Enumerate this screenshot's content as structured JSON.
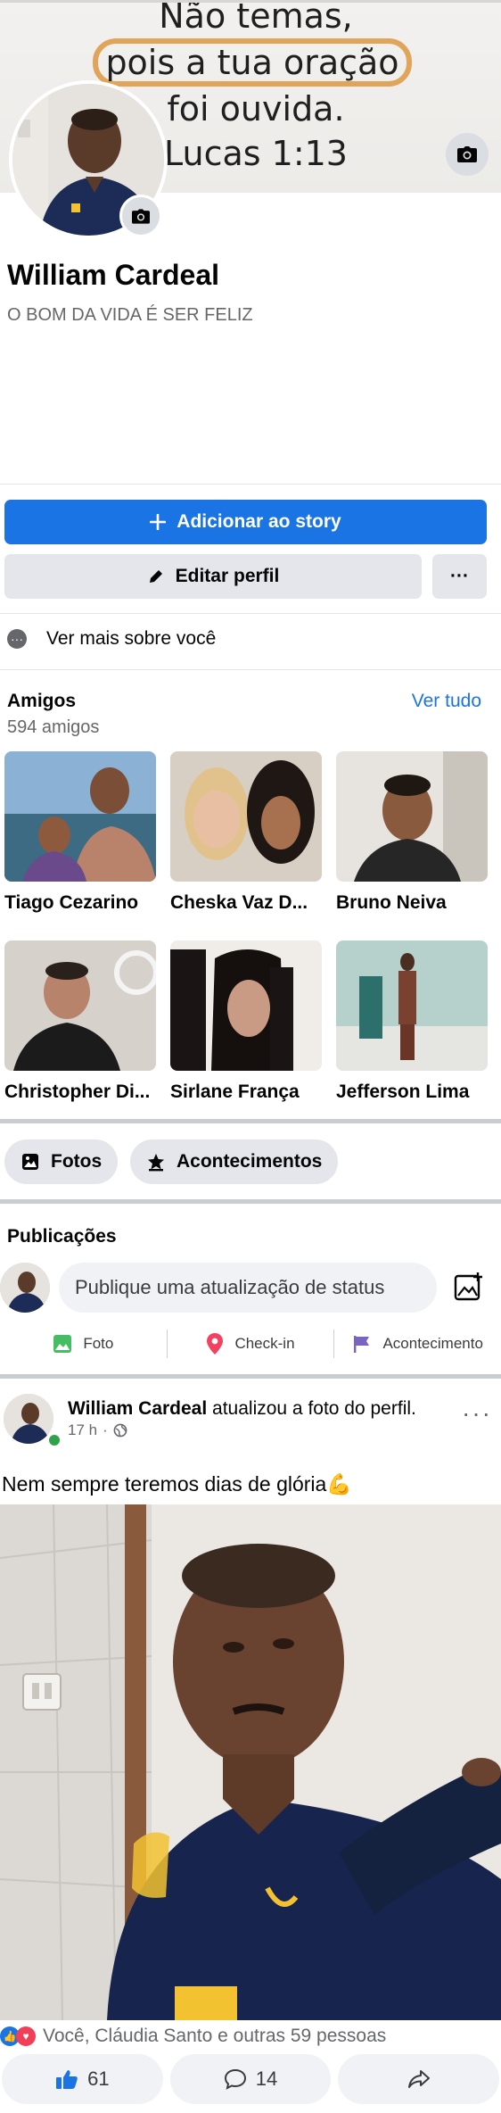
{
  "cover": {
    "lines": [
      "Não temas,",
      "pois a tua oração",
      "foi ouvida.",
      "Lucas 1:13"
    ]
  },
  "profile": {
    "name": "William Cardeal",
    "bio": "O BOM DA VIDA É SER FELIZ"
  },
  "buttons": {
    "add_story": "Adicionar ao story",
    "edit_profile": "Editar perfil",
    "more": "···"
  },
  "about": {
    "label": "Ver mais sobre você"
  },
  "friends": {
    "title": "Amigos",
    "count": "594 amigos",
    "see_all": "Ver tudo",
    "items": [
      {
        "name": "Tiago Cezarino"
      },
      {
        "name": "Cheska Vaz D..."
      },
      {
        "name": "Bruno Neiva"
      },
      {
        "name": "Christopher Di..."
      },
      {
        "name": "Sirlane França"
      },
      {
        "name": "Jefferson Lima"
      }
    ]
  },
  "pills": {
    "photos": "Fotos",
    "events": "Acontecimentos"
  },
  "publications": {
    "title": "Publicações",
    "placeholder": "Publique uma atualização de status",
    "actions": [
      "Foto",
      "Check-in",
      "Acontecimento"
    ]
  },
  "post": {
    "author": "William Cardeal",
    "action": " atualizou a foto do perfil.",
    "time": "17 h",
    "text": "Nem sempre teremos dias de glória💪",
    "reactions_text": "Você, Cláudia Santo e outras 59 pessoas",
    "likes": "61",
    "comments": "14"
  },
  "colors": {
    "primary": "#1b74e4",
    "secondary_bg": "#e4e6eb",
    "text_secondary": "#65676b",
    "online": "#31a24c"
  }
}
